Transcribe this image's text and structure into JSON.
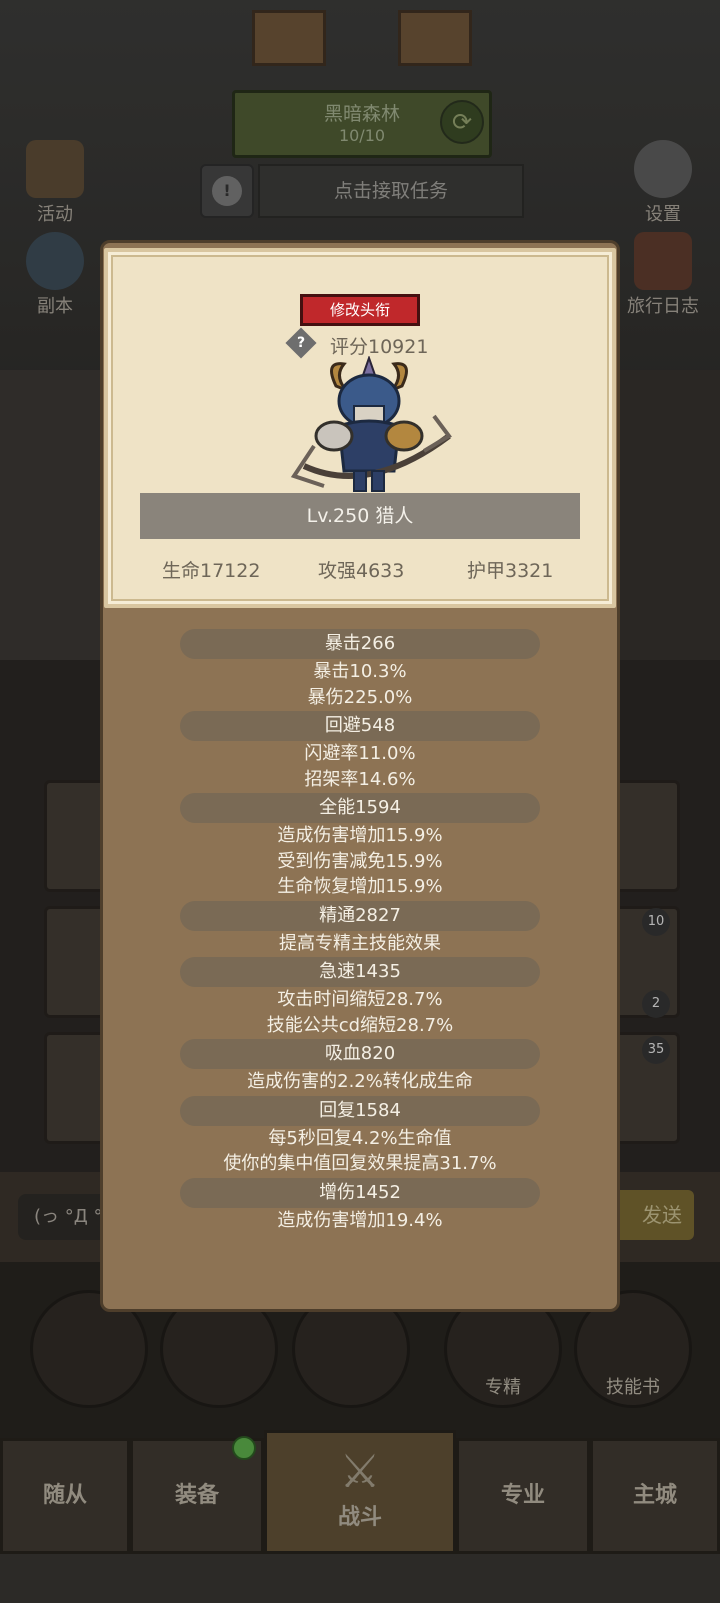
{
  "background": {
    "zone": {
      "name": "黑暗森林",
      "progress": "10/10"
    },
    "quest_button": "点击接取任务",
    "left_icons": [
      {
        "label": "活动"
      },
      {
        "label": "副本"
      }
    ],
    "right_icons": [
      {
        "label": "设置"
      },
      {
        "label": "旅行日志"
      }
    ],
    "chat": {
      "input": "(っ °Д °",
      "send": "发送"
    },
    "card_badges": [
      "10",
      "2",
      "35"
    ],
    "action_buttons": [
      {
        "label": ""
      },
      {
        "label": ""
      },
      {
        "label": ""
      },
      {
        "label": "专精"
      },
      {
        "label": "技能书"
      }
    ],
    "nav": [
      {
        "label": "随从"
      },
      {
        "label": "装备"
      },
      {
        "label": "战斗"
      },
      {
        "label": "专业"
      },
      {
        "label": "主城"
      }
    ]
  },
  "panel": {
    "title_button": "修改头衔",
    "help_icon": "?",
    "score": "评分10921",
    "avatar": "hunter-portrait-icon",
    "level_title": "Lv.250 猎人",
    "stats": {
      "hp": "生命17122",
      "attack": "攻强4633",
      "armor": "护甲3321"
    },
    "attributes": [
      {
        "header": "暴击266",
        "lines": [
          "暴击10.3%",
          "暴伤225.0%"
        ]
      },
      {
        "header": "回避548",
        "lines": [
          "闪避率11.0%",
          "招架率14.6%"
        ]
      },
      {
        "header": "全能1594",
        "lines": [
          "造成伤害增加15.9%",
          "受到伤害减免15.9%",
          "生命恢复增加15.9%"
        ]
      },
      {
        "header": "精通2827",
        "lines": [
          "提高专精主技能效果"
        ]
      },
      {
        "header": "急速1435",
        "lines": [
          "攻击时间缩短28.7%",
          "技能公共cd缩短28.7%"
        ]
      },
      {
        "header": "吸血820",
        "lines": [
          "造成伤害的2.2%转化成生命"
        ]
      },
      {
        "header": "回复1584",
        "lines": [
          "每5秒回复4.2%生命值",
          "使你的集中值回复效果提高31.7%"
        ]
      },
      {
        "header": "增伤1452",
        "lines": [
          "造成伤害增加19.4%"
        ]
      }
    ]
  },
  "colors": {
    "title_button": "#c0282b",
    "panel": "#8d7354",
    "card": "#efe3c6"
  }
}
